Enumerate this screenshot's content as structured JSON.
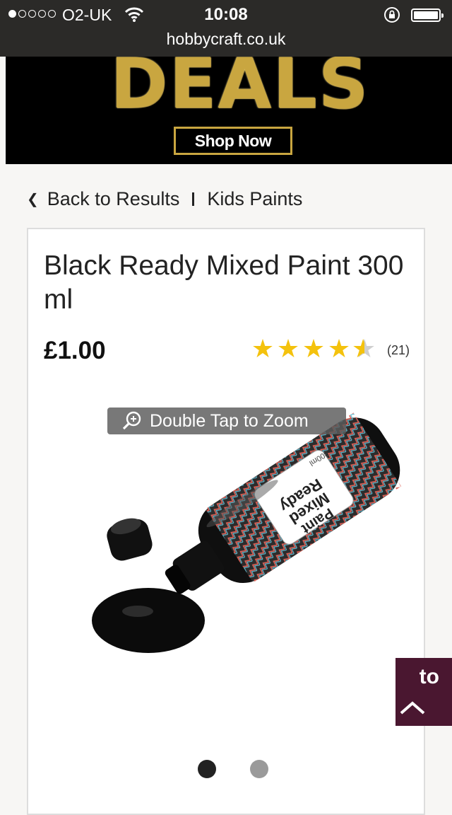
{
  "status_bar": {
    "carrier": "O2-UK",
    "time": "10:08",
    "signal_dots_filled": 1,
    "signal_dots_total": 5,
    "battery_level": 1.0
  },
  "browser": {
    "url": "hobbycraft.co.uk"
  },
  "banner": {
    "headline": "DEALS",
    "cta": "Shop Now",
    "accent_color": "#c9a640"
  },
  "breadcrumb": {
    "back": "Back to Results",
    "category": "Kids Paints"
  },
  "product": {
    "title": "Black Ready Mixed Paint 300 ml",
    "price": "£1.00",
    "rating": 4.5,
    "rating_max": 5,
    "reviews_count": "(21)",
    "zoom_hint": "Double Tap to Zoom",
    "label_text_1": "Ready",
    "label_text_2": "Mixed",
    "label_text_3": "Paint",
    "label_text_4": "300ml",
    "image_pages": 2,
    "image_current_page": 1
  },
  "back_to_top": {
    "label": "to",
    "icon": "chevron-up-icon",
    "color": "#4a1730"
  }
}
